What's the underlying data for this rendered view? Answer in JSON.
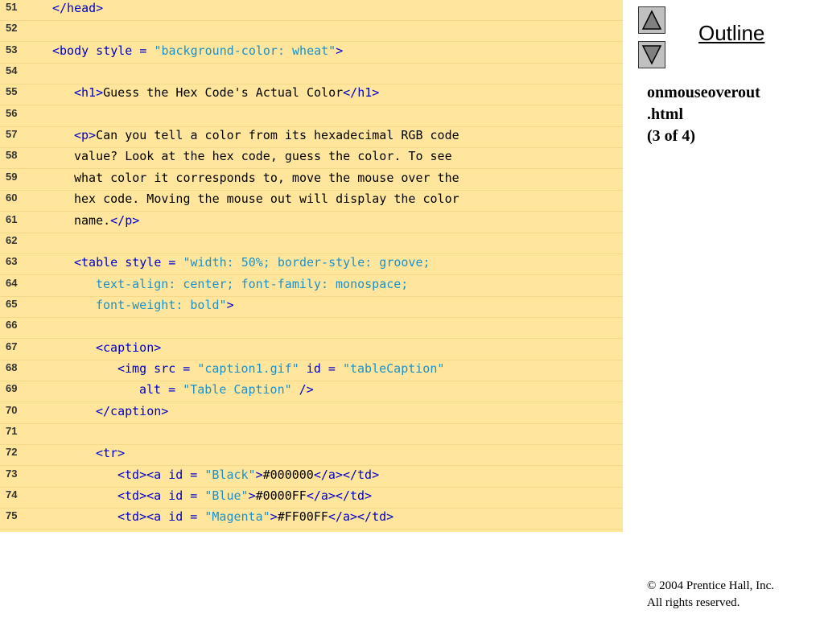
{
  "code": {
    "lines": [
      {
        "no": "51",
        "indent": 2,
        "segs": [
          {
            "t": "tag",
            "v": "</head>"
          }
        ]
      },
      {
        "no": "52",
        "indent": 0,
        "segs": []
      },
      {
        "no": "53",
        "indent": 2,
        "segs": [
          {
            "t": "tag",
            "v": "<body style = "
          },
          {
            "t": "str",
            "v": "\"background-color: wheat\""
          },
          {
            "t": "tag",
            "v": ">"
          }
        ]
      },
      {
        "no": "54",
        "indent": 0,
        "segs": []
      },
      {
        "no": "55",
        "indent": 5,
        "segs": [
          {
            "t": "tag",
            "v": "<h1>"
          },
          {
            "t": "text",
            "v": "Guess the Hex Code's Actual Color"
          },
          {
            "t": "tag",
            "v": "</h1>"
          }
        ]
      },
      {
        "no": "56",
        "indent": 0,
        "segs": []
      },
      {
        "no": "57",
        "indent": 5,
        "segs": [
          {
            "t": "tag",
            "v": "<p>"
          },
          {
            "t": "text",
            "v": "Can you tell a color from its hexadecimal RGB code"
          }
        ]
      },
      {
        "no": "58",
        "indent": 5,
        "segs": [
          {
            "t": "text",
            "v": "value? Look at the hex code, guess the color. To see"
          }
        ]
      },
      {
        "no": "59",
        "indent": 5,
        "segs": [
          {
            "t": "text",
            "v": "what color it corresponds to, move the mouse over the"
          }
        ]
      },
      {
        "no": "60",
        "indent": 5,
        "segs": [
          {
            "t": "text",
            "v": "hex code. Moving the mouse out will display the color"
          }
        ]
      },
      {
        "no": "61",
        "indent": 5,
        "segs": [
          {
            "t": "text",
            "v": "name."
          },
          {
            "t": "tag",
            "v": "</p>"
          }
        ]
      },
      {
        "no": "62",
        "indent": 0,
        "segs": []
      },
      {
        "no": "63",
        "indent": 5,
        "segs": [
          {
            "t": "tag",
            "v": "<table style = "
          },
          {
            "t": "str",
            "v": "\"width: 50%; border-style: groove;"
          }
        ]
      },
      {
        "no": "64",
        "indent": 8,
        "segs": [
          {
            "t": "str",
            "v": "text-align: center; font-family: monospace;"
          }
        ]
      },
      {
        "no": "65",
        "indent": 8,
        "segs": [
          {
            "t": "str",
            "v": "font-weight: bold\""
          },
          {
            "t": "tag",
            "v": ">"
          }
        ]
      },
      {
        "no": "66",
        "indent": 0,
        "segs": []
      },
      {
        "no": "67",
        "indent": 8,
        "segs": [
          {
            "t": "tag",
            "v": "<caption>"
          }
        ]
      },
      {
        "no": "68",
        "indent": 11,
        "segs": [
          {
            "t": "tag",
            "v": "<img src = "
          },
          {
            "t": "str",
            "v": "\"caption1.gif\""
          },
          {
            "t": "tag",
            "v": " id = "
          },
          {
            "t": "str",
            "v": "\"tableCaption\""
          }
        ]
      },
      {
        "no": "69",
        "indent": 14,
        "segs": [
          {
            "t": "tag",
            "v": "alt = "
          },
          {
            "t": "str",
            "v": "\"Table Caption\""
          },
          {
            "t": "tag",
            "v": " />"
          }
        ]
      },
      {
        "no": "70",
        "indent": 8,
        "segs": [
          {
            "t": "tag",
            "v": "</caption>"
          }
        ]
      },
      {
        "no": "71",
        "indent": 0,
        "segs": []
      },
      {
        "no": "72",
        "indent": 8,
        "segs": [
          {
            "t": "tag",
            "v": "<tr>"
          }
        ]
      },
      {
        "no": "73",
        "indent": 11,
        "segs": [
          {
            "t": "tag",
            "v": "<td><a id = "
          },
          {
            "t": "str",
            "v": "\"Black\""
          },
          {
            "t": "tag",
            "v": ">"
          },
          {
            "t": "text",
            "v": "#000000"
          },
          {
            "t": "tag",
            "v": "</a></td>"
          }
        ]
      },
      {
        "no": "74",
        "indent": 11,
        "segs": [
          {
            "t": "tag",
            "v": "<td><a id = "
          },
          {
            "t": "str",
            "v": "\"Blue\""
          },
          {
            "t": "tag",
            "v": ">"
          },
          {
            "t": "text",
            "v": "#0000FF"
          },
          {
            "t": "tag",
            "v": "</a></td>"
          }
        ]
      },
      {
        "no": "75",
        "indent": 11,
        "segs": [
          {
            "t": "tag",
            "v": "<td><a id = "
          },
          {
            "t": "str",
            "v": "\"Magenta\""
          },
          {
            "t": "tag",
            "v": ">"
          },
          {
            "t": "text",
            "v": "#FF00FF"
          },
          {
            "t": "tag",
            "v": "</a></td>"
          }
        ]
      }
    ]
  },
  "sidebar": {
    "outline_label": "Outline",
    "file_lines": [
      "onmouseoverout",
      ".html",
      "(3 of 4)"
    ],
    "up_icon": "up-arrow-icon",
    "down_icon": "down-arrow-icon"
  },
  "footer": {
    "copyright_symbol": "©",
    "copyright_line": " 2004 Prentice Hall, Inc.",
    "rights_line": "All rights reserved."
  },
  "colors": {
    "code_background": "#FFE69C",
    "tag": "#0000CC",
    "string": "#1E90C8",
    "text": "#000000"
  }
}
